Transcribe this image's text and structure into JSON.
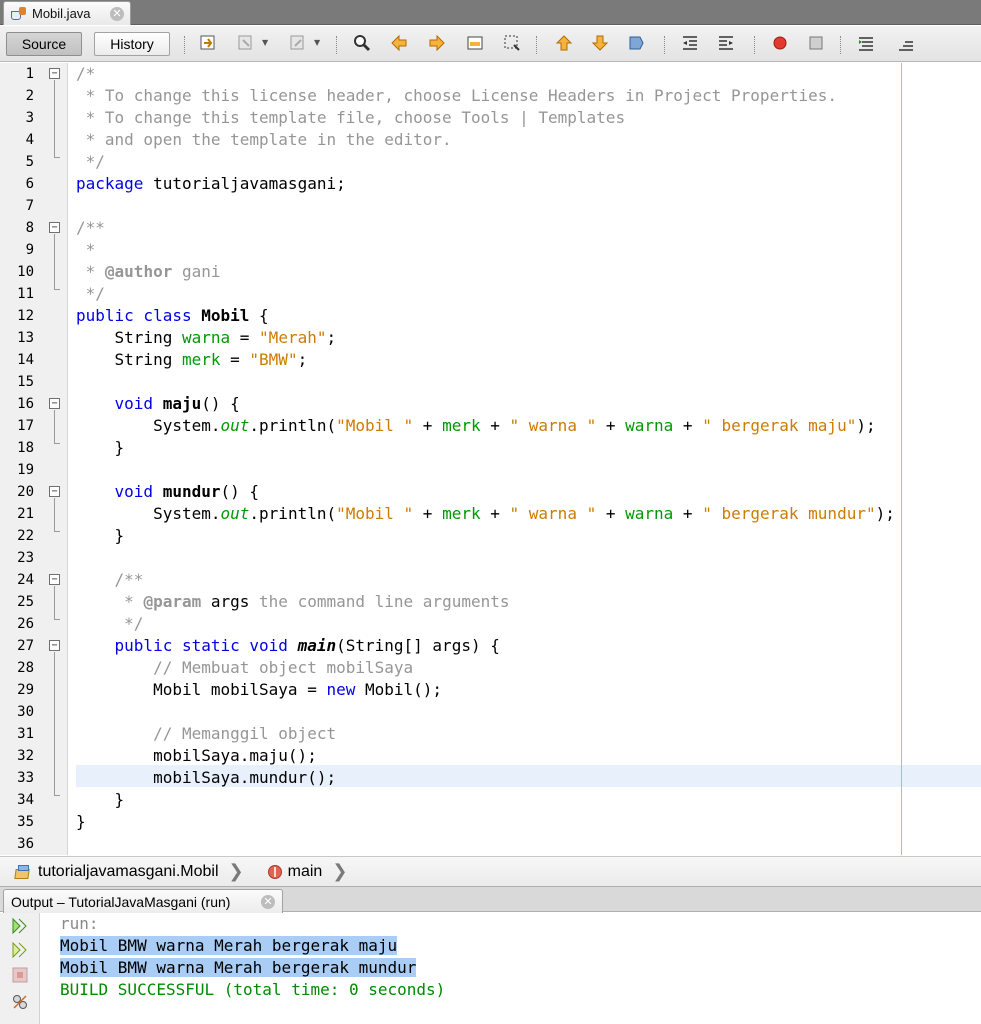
{
  "editor_tab": {
    "filename": "Mobil.java",
    "close_symbol": "✕"
  },
  "toolbar": {
    "source_label": "Source",
    "history_label": "History"
  },
  "gutter_lines": [
    "1",
    "2",
    "3",
    "4",
    "5",
    "6",
    "7",
    "8",
    "9",
    "10",
    "11",
    "12",
    "13",
    "14",
    "15",
    "16",
    "17",
    "18",
    "19",
    "20",
    "21",
    "22",
    "23",
    "24",
    "25",
    "26",
    "27",
    "28",
    "29",
    "30",
    "31",
    "32",
    "33",
    "34",
    "35",
    "36"
  ],
  "code": {
    "l1": "/*",
    "l2": " * To change this license header, choose License Headers in Project Properties.",
    "l3": " * To change this template file, choose Tools | Templates",
    "l4": " * and open the template in the editor.",
    "l5": " */",
    "l6_kw": "package",
    "l6_rest": " tutorialjavamasgani;",
    "l8": "/**",
    "l9": " *",
    "l10_a": " * ",
    "l10_tag": "@author",
    "l10_b": " gani",
    "l11": " */",
    "l12_kw": "public class",
    "l12_name": "Mobil",
    "l12_rest": " {",
    "l13_a": "    String ",
    "l13_field": "warna",
    "l13_b": " = ",
    "l13_str": "\"Merah\"",
    "l13_c": ";",
    "l14_a": "    String ",
    "l14_field": "merk",
    "l14_b": " = ",
    "l14_str": "\"BMW\"",
    "l14_c": ";",
    "l16_kw": "    void",
    "l16_name": "maju",
    "l16_rest": "() {",
    "l17_a": "        System.",
    "l17_out": "out",
    "l17_b": ".println(",
    "l17_s1": "\"Mobil \"",
    "l17_p1": " + ",
    "l17_f1": "merk",
    "l17_p2": " + ",
    "l17_s2": "\" warna \"",
    "l17_p3": " + ",
    "l17_f2": "warna",
    "l17_p4": " + ",
    "l17_s3": "\" bergerak maju\"",
    "l17_end": ");",
    "l18": "    }",
    "l20_kw": "    void",
    "l20_name": "mundur",
    "l20_rest": "() {",
    "l21_a": "        System.",
    "l21_out": "out",
    "l21_b": ".println(",
    "l21_s1": "\"Mobil \"",
    "l21_p1": " + ",
    "l21_f1": "merk",
    "l21_p2": " + ",
    "l21_s2": "\" warna \"",
    "l21_p3": " + ",
    "l21_f2": "warna",
    "l21_p4": " + ",
    "l21_s3": "\" bergerak mundur\"",
    "l21_end": ");",
    "l22": "    }",
    "l24": "    /**",
    "l25_a": "     * ",
    "l25_tag": "@param",
    "l25_name": " args",
    "l25_b": " the command line arguments",
    "l26": "     */",
    "l27_kw": "    public static void",
    "l27_name": "main",
    "l27_rest": "(String[] args) {",
    "l28": "        // Membuat object mobilSaya",
    "l29_a": "        Mobil mobilSaya = ",
    "l29_kw": "new",
    "l29_b": " Mobil();",
    "l31": "        // Memanggil object",
    "l32": "        mobilSaya.maju();",
    "l33": "        mobilSaya.mundur();",
    "l34": "    }",
    "l35": "}"
  },
  "breadcrumb": {
    "class_path": "tutorialjavamasgani.Mobil",
    "method": "main",
    "separator": "❯"
  },
  "output": {
    "tab_label": "Output – TutorialJavaMasgani (run)",
    "close_symbol": "✕",
    "lines": {
      "run": "run:",
      "line1": "Mobil BMW warna Merah bergerak maju",
      "line2": "Mobil BMW warna Merah bergerak mundur",
      "build": "BUILD SUCCESSFUL (total time: 0 seconds)"
    }
  },
  "colors": {
    "keyword": "#0000e6",
    "string": "#ce7b00",
    "field": "#009900",
    "comment": "#969696",
    "selection": "#a9cdf5",
    "build_success": "#008a00"
  }
}
